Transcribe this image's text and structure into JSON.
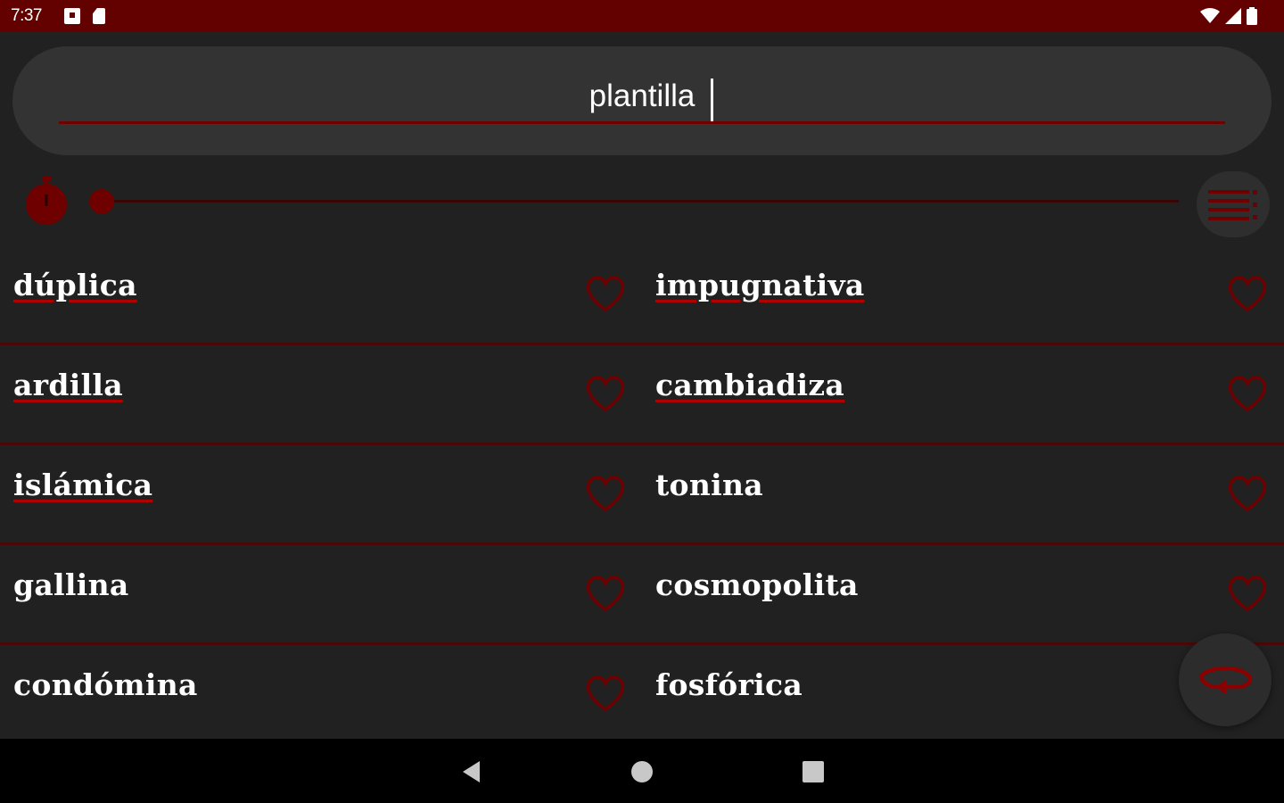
{
  "status_bar": {
    "time": "7:37",
    "left_icons": [
      "notification-square-icon",
      "sd-card-icon"
    ],
    "right_icons": [
      "wifi-icon",
      "cell-signal-icon",
      "battery-icon"
    ]
  },
  "search": {
    "value": "plantilla"
  },
  "controls": {
    "timer_icon": "stopwatch-icon",
    "menu_icon": "list-menu-icon",
    "slider_value": 0
  },
  "words": {
    "left": [
      {
        "label": "dúplica",
        "linked": true
      },
      {
        "label": "ardilla",
        "linked": true
      },
      {
        "label": "islámica",
        "linked": true
      },
      {
        "label": "gallina",
        "linked": false
      },
      {
        "label": "condómina",
        "linked": false
      }
    ],
    "right": [
      {
        "label": "impugnativa",
        "linked": true
      },
      {
        "label": "cambiadiza",
        "linked": true
      },
      {
        "label": "tonina",
        "linked": false
      },
      {
        "label": "cosmopolita",
        "linked": false
      },
      {
        "label": "fosfórica",
        "linked": false
      }
    ]
  },
  "fab": {
    "icon": "refresh-icon"
  },
  "nav_bar": {
    "buttons": [
      "back-icon",
      "home-icon",
      "recents-icon"
    ]
  },
  "colors": {
    "accent": "#630000",
    "accent_bright": "#8b0000",
    "background": "#212121",
    "surface": "#333333",
    "text": "#ffffff"
  }
}
